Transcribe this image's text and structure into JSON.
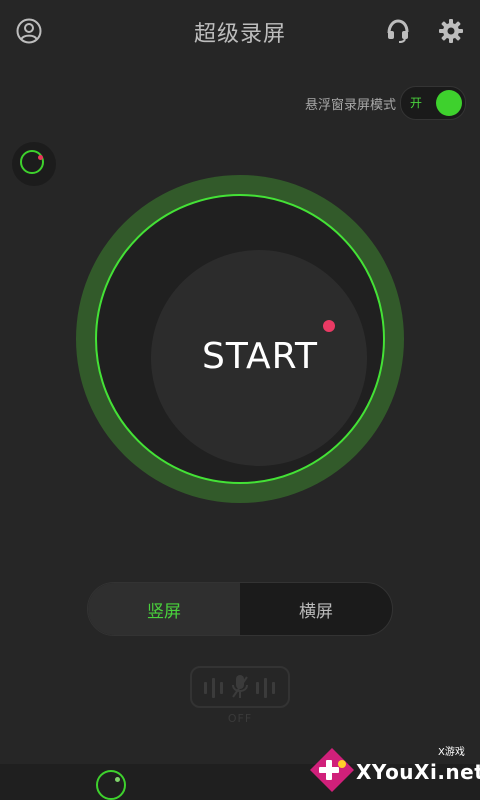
{
  "header": {
    "title": "超级录屏",
    "account_icon": "user-circle-icon",
    "headset_icon": "headset-icon",
    "settings_icon": "gear-icon"
  },
  "float_mode": {
    "label": "悬浮窗录屏模式",
    "state_text": "开",
    "enabled": true
  },
  "record": {
    "label": "START"
  },
  "orientation": {
    "portrait": "竖屏",
    "landscape": "横屏",
    "selected": "portrait"
  },
  "mic": {
    "icon": "microphone-muted-icon",
    "state": "OFF"
  },
  "watermark": {
    "top": "X游戏",
    "main": "XYouXi.net"
  },
  "colors": {
    "accent": "#3ed12d",
    "record_dot": "#ea3a64",
    "background": "#262626"
  }
}
